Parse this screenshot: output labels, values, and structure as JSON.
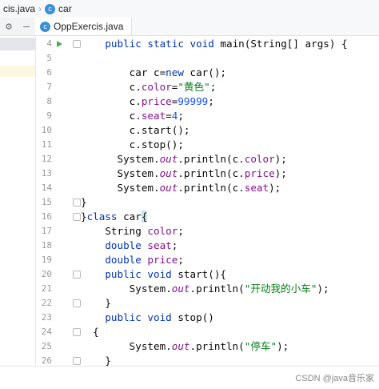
{
  "breadcrumb": {
    "file": "cis.java",
    "class_icon_letter": "c",
    "class_name": "car"
  },
  "toolbar": {
    "gear_icon": "⚙",
    "minimize_icon": "—"
  },
  "tab": {
    "icon_letter": "c",
    "label": "OppExercis.java"
  },
  "lines": [
    {
      "n": "4",
      "run": true,
      "fold": true,
      "segs": [
        [
          "    ",
          ""
        ],
        [
          "public static void ",
          "kw"
        ],
        [
          "main(String[] args) {",
          ""
        ]
      ]
    },
    {
      "n": "5",
      "segs": []
    },
    {
      "n": "6",
      "segs": [
        [
          "        car c=",
          ""
        ],
        [
          "new ",
          "kw"
        ],
        [
          "car();",
          ""
        ]
      ]
    },
    {
      "n": "7",
      "segs": [
        [
          "        c.",
          ""
        ],
        [
          "color",
          "fld"
        ],
        [
          "=",
          ""
        ],
        [
          "\"黄色\"",
          "str"
        ],
        [
          ";",
          ""
        ]
      ]
    },
    {
      "n": "8",
      "segs": [
        [
          "        c.",
          ""
        ],
        [
          "price",
          "fld"
        ],
        [
          "=",
          ""
        ],
        [
          "99999",
          "num"
        ],
        [
          ";",
          ""
        ]
      ]
    },
    {
      "n": "9",
      "segs": [
        [
          "        c.",
          ""
        ],
        [
          "seat",
          "fld"
        ],
        [
          "=",
          ""
        ],
        [
          "4",
          "num"
        ],
        [
          ";",
          ""
        ]
      ]
    },
    {
      "n": "10",
      "segs": [
        [
          "        c.start();",
          ""
        ]
      ]
    },
    {
      "n": "11",
      "segs": [
        [
          "        c.stop();",
          ""
        ]
      ]
    },
    {
      "n": "12",
      "segs": [
        [
          "      System.",
          ""
        ],
        [
          "out",
          "ital"
        ],
        [
          ".println(c.",
          ""
        ],
        [
          "color",
          "fld"
        ],
        [
          ");",
          ""
        ]
      ]
    },
    {
      "n": "13",
      "segs": [
        [
          "      System.",
          ""
        ],
        [
          "out",
          "ital"
        ],
        [
          ".println(c.",
          ""
        ],
        [
          "price",
          "fld"
        ],
        [
          ");",
          ""
        ]
      ]
    },
    {
      "n": "14",
      "segs": [
        [
          "      System.",
          ""
        ],
        [
          "out",
          "ital"
        ],
        [
          ".println(c.",
          ""
        ],
        [
          "seat",
          "fld"
        ],
        [
          ");",
          ""
        ]
      ]
    },
    {
      "n": "15",
      "fold": true,
      "segs": [
        [
          "}",
          ""
        ]
      ]
    },
    {
      "n": "16",
      "fold": true,
      "segs": [
        [
          "}",
          ""
        ],
        [
          "class ",
          "kw"
        ],
        [
          "car",
          ""
        ],
        [
          "{",
          "hl"
        ]
      ]
    },
    {
      "n": "17",
      "segs": [
        [
          "    String ",
          ""
        ],
        [
          "color",
          "fld"
        ],
        [
          ";",
          ""
        ]
      ]
    },
    {
      "n": "18",
      "segs": [
        [
          "    ",
          ""
        ],
        [
          "double ",
          "kw"
        ],
        [
          "seat",
          "fld"
        ],
        [
          ";",
          ""
        ]
      ]
    },
    {
      "n": "19",
      "segs": [
        [
          "    ",
          ""
        ],
        [
          "double ",
          "kw"
        ],
        [
          "price",
          "fld"
        ],
        [
          ";",
          ""
        ]
      ]
    },
    {
      "n": "20",
      "fold": true,
      "segs": [
        [
          "    ",
          ""
        ],
        [
          "public void ",
          "kw"
        ],
        [
          "start(){",
          ""
        ]
      ]
    },
    {
      "n": "21",
      "segs": [
        [
          "        System.",
          ""
        ],
        [
          "out",
          "ital"
        ],
        [
          ".println(",
          ""
        ],
        [
          "\"开动我的小车\"",
          "str"
        ],
        [
          ");",
          ""
        ]
      ]
    },
    {
      "n": "22",
      "fold": true,
      "segs": [
        [
          "    }",
          ""
        ]
      ]
    },
    {
      "n": "23",
      "segs": [
        [
          "    ",
          ""
        ],
        [
          "public void ",
          "kw"
        ],
        [
          "stop()",
          ""
        ]
      ]
    },
    {
      "n": "24",
      "fold": true,
      "segs": [
        [
          "  {",
          ""
        ]
      ]
    },
    {
      "n": "25",
      "segs": [
        [
          "        System.",
          ""
        ],
        [
          "out",
          "ital"
        ],
        [
          ".println(",
          ""
        ],
        [
          "\"停车\"",
          "str"
        ],
        [
          ");",
          ""
        ]
      ]
    },
    {
      "n": "26",
      "fold": true,
      "segs": [
        [
          "    }",
          ""
        ]
      ]
    }
  ],
  "watermark": "CSDN @java音乐家"
}
